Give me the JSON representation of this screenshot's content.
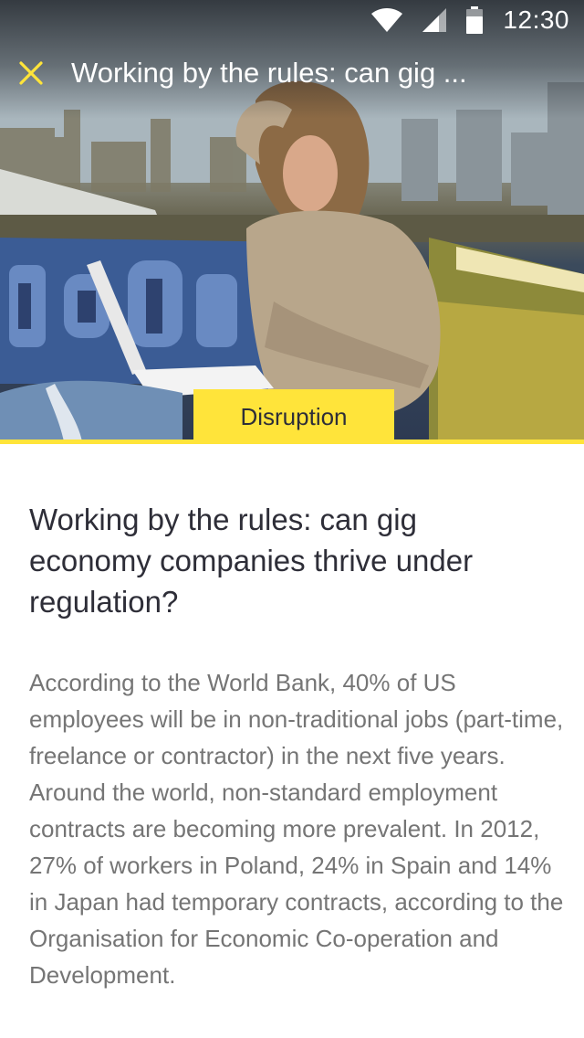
{
  "status_bar": {
    "time": "12:30",
    "icons": [
      "wifi-icon",
      "cell-signal-icon",
      "battery-icon"
    ]
  },
  "toolbar": {
    "close_icon": "close-icon",
    "title": "Working by the rules: can gig ..."
  },
  "hero": {
    "image_subject": "woman-with-laptop-on-rooftop-photo",
    "category": "Disruption"
  },
  "article": {
    "headline": "Working by the rules: can gig economy companies thrive under regulation?",
    "paragraphs": [
      "According to the World Bank, 40% of US employees will be in non-traditional jobs (part-time, freelance or contractor) in the next five years.",
      "Around the world, non-standard employment contracts are becoming more prevalent. In 2012, 27% of workers in Poland, 24% in Spain and 14% in Japan had temporary contracts, according to the Organisation for Economic Co-operation and Development."
    ]
  },
  "colors": {
    "accent": "#ffe43a",
    "headline": "#2e2e38",
    "body_text": "#757575",
    "toolbar_icon": "#ffe43a"
  }
}
